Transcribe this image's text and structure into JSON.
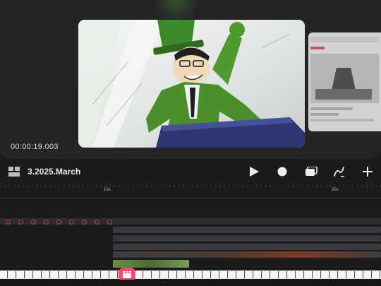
{
  "preview": {
    "timecode": "00:00:19.003"
  },
  "toolbar": {
    "project_title": "3.2025.March",
    "icons": [
      "gallery-icon",
      "play-icon",
      "record-icon",
      "frames-icon",
      "brush-icon",
      "add-icon"
    ]
  },
  "ruler": {
    "major_labels": [
      {
        "text": "10s"
      },
      {
        "text": "20s"
      }
    ]
  },
  "colors": {
    "accent": "#f24b6a",
    "background": "#1b1b1d",
    "panel": "#242427"
  }
}
